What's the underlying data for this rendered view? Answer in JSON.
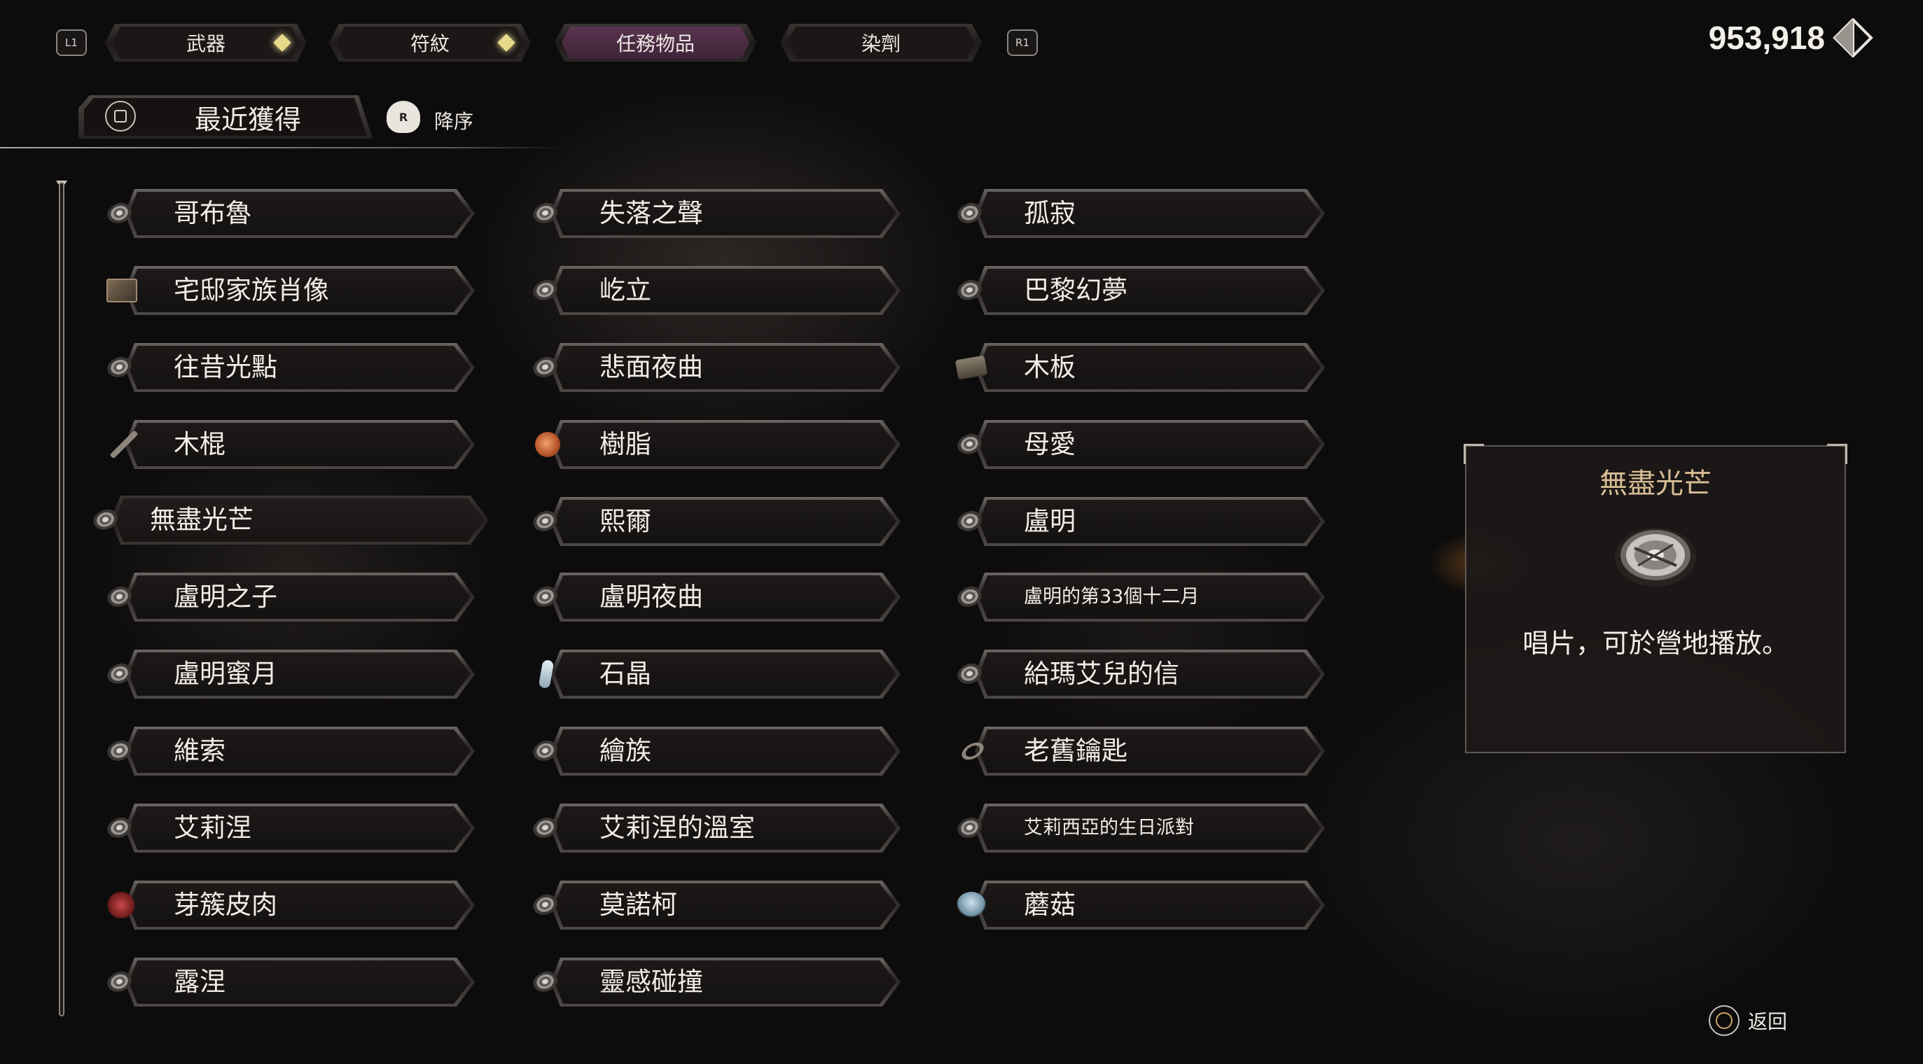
{
  "top_bar": {
    "left_shoulder": "L1",
    "right_shoulder": "R1",
    "tabs": [
      {
        "label": "武器",
        "has_new": true
      },
      {
        "label": "符紋",
        "has_new": true
      },
      {
        "label": "任務物品",
        "has_new": false,
        "active": true
      },
      {
        "label": "染劑",
        "has_new": false
      }
    ],
    "currency_amount": "953,918",
    "currency_icon": "shard-currency-icon"
  },
  "sort": {
    "button_icon": "square-button-icon",
    "label": "最近獲得",
    "order_button_icon": "right-stick-icon",
    "order_button_glyph": "R",
    "order_label": "降序"
  },
  "items": {
    "columns": [
      [
        {
          "label": "哥布魯",
          "icon": "record-disc-icon"
        },
        {
          "label": "宅邸家族肖像",
          "icon": "portrait-icon"
        },
        {
          "label": "往昔光點",
          "icon": "record-disc-icon"
        },
        {
          "label": "木棍",
          "icon": "stick-icon"
        },
        {
          "label": "無盡光芒",
          "icon": "record-disc-icon",
          "selected": true
        },
        {
          "label": "盧明之子",
          "icon": "record-disc-icon"
        },
        {
          "label": "盧明蜜月",
          "icon": "record-disc-icon"
        },
        {
          "label": "維索",
          "icon": "record-disc-icon"
        },
        {
          "label": "艾莉涅",
          "icon": "record-disc-icon"
        },
        {
          "label": "芽簇皮肉",
          "icon": "flesh-icon"
        },
        {
          "label": "露涅",
          "icon": "record-disc-icon"
        }
      ],
      [
        {
          "label": "失落之聲",
          "icon": "record-disc-icon"
        },
        {
          "label": "屹立",
          "icon": "record-disc-icon"
        },
        {
          "label": "悲面夜曲",
          "icon": "record-disc-icon"
        },
        {
          "label": "樹脂",
          "icon": "resin-icon"
        },
        {
          "label": "熙爾",
          "icon": "record-disc-icon"
        },
        {
          "label": "盧明夜曲",
          "icon": "record-disc-icon"
        },
        {
          "label": "石晶",
          "icon": "crystal-icon"
        },
        {
          "label": "繪族",
          "icon": "record-disc-icon"
        },
        {
          "label": "艾莉涅的溫室",
          "icon": "record-disc-icon"
        },
        {
          "label": "莫諾柯",
          "icon": "record-disc-icon"
        },
        {
          "label": "靈感碰撞",
          "icon": "record-disc-icon"
        }
      ],
      [
        {
          "label": "孤寂",
          "icon": "record-disc-icon"
        },
        {
          "label": "巴黎幻夢",
          "icon": "record-disc-icon"
        },
        {
          "label": "木板",
          "icon": "plank-icon"
        },
        {
          "label": "母愛",
          "icon": "record-disc-icon"
        },
        {
          "label": "盧明",
          "icon": "record-disc-icon"
        },
        {
          "label": "盧明的第33個十二月",
          "icon": "record-disc-icon",
          "small": true
        },
        {
          "label": "給瑪艾兒的信",
          "icon": "record-disc-icon"
        },
        {
          "label": "老舊鑰匙",
          "icon": "key-icon"
        },
        {
          "label": "艾莉西亞的生日派對",
          "icon": "record-disc-icon",
          "small": true
        },
        {
          "label": "蘑菇",
          "icon": "mushroom-icon"
        }
      ]
    ]
  },
  "detail": {
    "title": "無盡光芒",
    "icon": "record-disc-icon",
    "description": "唱片，可於營地播放。"
  },
  "footer": {
    "back_icon": "circle-button-icon",
    "back_label": "返回"
  },
  "colors": {
    "background": "#0d0c0c",
    "active_tab": "#4a2c44",
    "detail_title": "#d8bd96",
    "new_marker": "#e8d88a"
  }
}
